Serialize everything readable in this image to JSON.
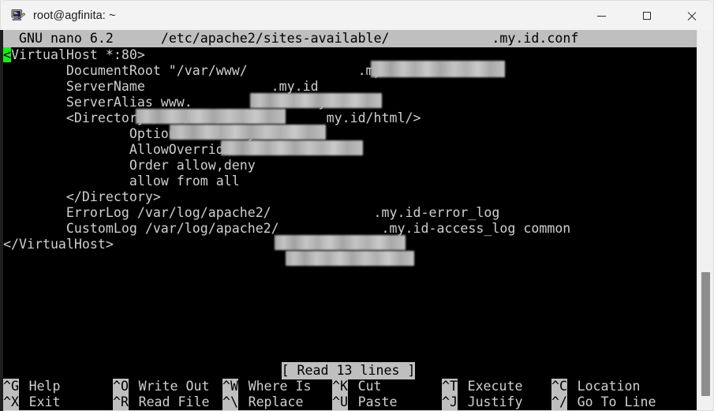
{
  "window": {
    "title": "root@agfinita: ~",
    "icon": "putty-terminal-icon",
    "controls": {
      "minimize": "minimize-icon",
      "maximize": "maximize-icon",
      "close": "close-icon"
    }
  },
  "nano": {
    "title_bar": {
      "version": "  GNU nano 6.2",
      "path_prefix": "/etc/apache2/sites-available/",
      "path_suffix": ".my.id.conf"
    },
    "lines": [
      {
        "text": "<VirtualHost *:80>",
        "cursor_col": 0
      },
      {
        "text": "        DocumentRoot \"/var/www/            .my.id/html\""
      },
      {
        "text": "        ServerName                .my.id"
      },
      {
        "text": "        ServerAlias www.             .my.id"
      },
      {
        "text": "        <Directory /var/www/r           my.id/html/>"
      },
      {
        "text": "                Options FollowSymLinks"
      },
      {
        "text": "                AllowOverride All"
      },
      {
        "text": "                Order allow,deny"
      },
      {
        "text": "                allow from all"
      },
      {
        "text": "        </Directory>"
      },
      {
        "text": "        ErrorLog /var/log/apache2/            .my.id-error_log"
      },
      {
        "text": "        CustomLog /var/log/apache2/            .my.id-access_log common"
      },
      {
        "text": "</VirtualHost>"
      }
    ],
    "status_message": "[ Read 13 lines ]",
    "shortcuts_row1": [
      {
        "key": "^G",
        "label": "Help"
      },
      {
        "key": "^O",
        "label": "Write Out"
      },
      {
        "key": "^W",
        "label": "Where Is"
      },
      {
        "key": "^K",
        "label": "Cut"
      },
      {
        "key": "^T",
        "label": "Execute"
      },
      {
        "key": "^C",
        "label": "Location"
      }
    ],
    "shortcuts_row2": [
      {
        "key": "^X",
        "label": "Exit"
      },
      {
        "key": "^R",
        "label": "Read File"
      },
      {
        "key": "^\\",
        "label": "Replace"
      },
      {
        "key": "^U",
        "label": "Paste"
      },
      {
        "key": "^J",
        "label": "Justify"
      },
      {
        "key": "^/",
        "label": "Go To Line"
      }
    ]
  },
  "colors": {
    "terminal_bg": "#000000",
    "terminal_fg": "#cfcfd4",
    "reverse_bg": "#bfbfbf",
    "reverse_fg": "#000000",
    "cursor": "#14f014",
    "redaction": "#b9b9b9",
    "titlebar_bg": "#f3f3f3",
    "scrollbar_thumb": "#8d8d8d"
  }
}
